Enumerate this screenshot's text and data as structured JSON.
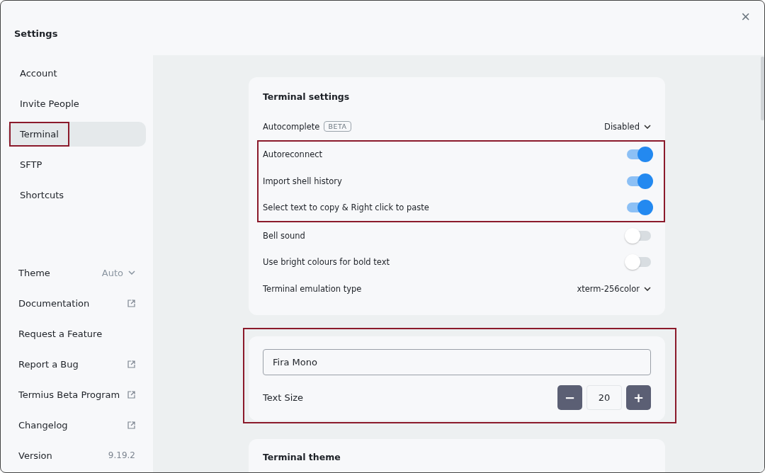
{
  "window": {
    "title": "Settings",
    "close": "×"
  },
  "sidebar": {
    "items": [
      {
        "label": "Account",
        "selected": false,
        "annotated": false
      },
      {
        "label": "Invite People",
        "selected": false,
        "annotated": false
      },
      {
        "label": "Terminal",
        "selected": true,
        "annotated": true
      },
      {
        "label": "SFTP",
        "selected": false,
        "annotated": false
      },
      {
        "label": "Shortcuts",
        "selected": false,
        "annotated": false
      }
    ],
    "footer": [
      {
        "kind": "select",
        "label": "Theme",
        "value": "Auto"
      },
      {
        "kind": "external",
        "label": "Documentation"
      },
      {
        "kind": "plain",
        "label": "Request a Feature"
      },
      {
        "kind": "external",
        "label": "Report a Bug"
      },
      {
        "kind": "external",
        "label": "Termius Beta Program"
      },
      {
        "kind": "external",
        "label": "Changelog"
      },
      {
        "kind": "info",
        "label": "Version",
        "value": "9.19.2"
      }
    ]
  },
  "terminal_settings": {
    "title": "Terminal settings",
    "rows": [
      {
        "kind": "select",
        "label": "Autocomplete",
        "badge": "BETA",
        "value": "Disabled"
      },
      {
        "kind": "group",
        "annotated": true,
        "rows": [
          {
            "kind": "toggle",
            "label": "Autoreconnect",
            "on": true
          },
          {
            "kind": "toggle",
            "label": "Import shell history",
            "on": true
          },
          {
            "kind": "toggle",
            "label": "Select text to copy & Right click to paste",
            "on": true
          }
        ]
      },
      {
        "kind": "toggle",
        "label": "Bell sound",
        "on": false
      },
      {
        "kind": "toggle",
        "label": "Use bright colours for bold text",
        "on": false
      },
      {
        "kind": "select",
        "label": "Terminal emulation type",
        "value": "xterm-256color"
      }
    ]
  },
  "font_card": {
    "annotated": true,
    "font": "Fira Mono",
    "text_size_label": "Text Size",
    "text_size": "20",
    "minus": "−",
    "plus": "+"
  },
  "theme_card": {
    "title": "Terminal theme"
  }
}
